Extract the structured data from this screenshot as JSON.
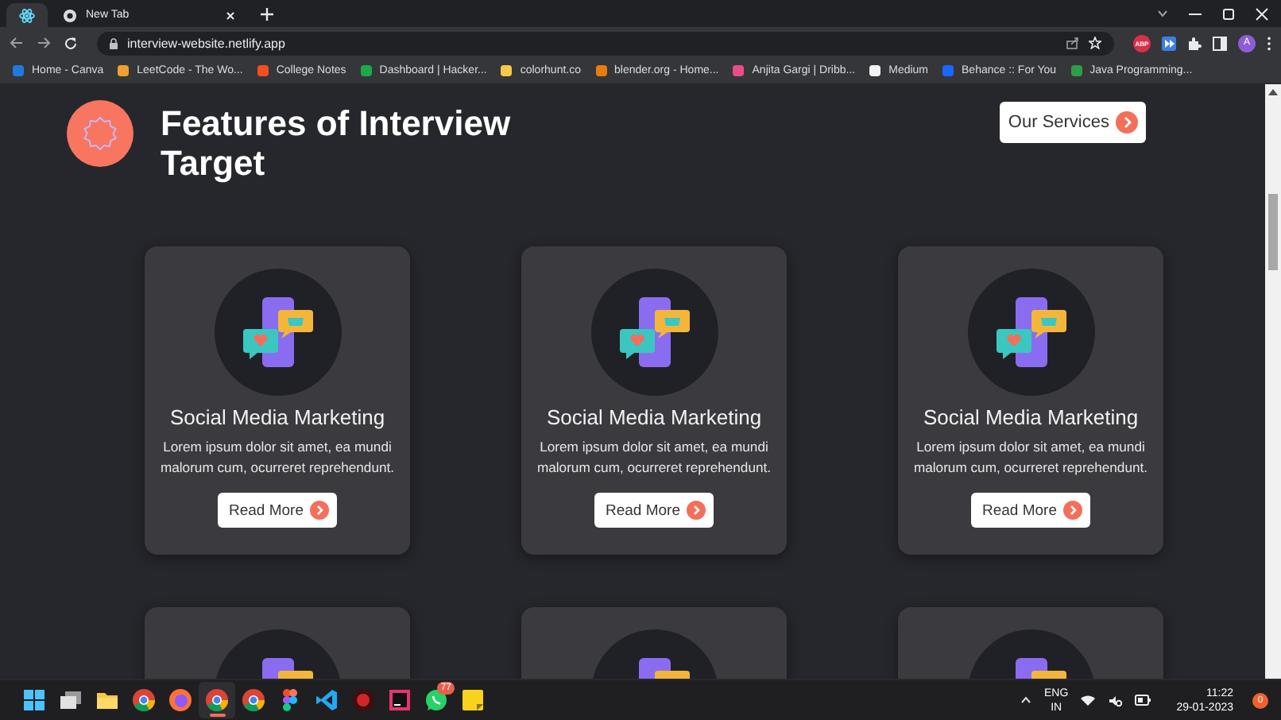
{
  "browser": {
    "tabs": [
      {
        "kind": "pinned",
        "selected": true
      },
      {
        "kind": "normal",
        "title": "New Tab",
        "selected": false
      }
    ],
    "address": "interview-website.netlify.app",
    "extension_label": "ABP",
    "profile_initial": "A",
    "bookmarks": [
      {
        "label": "Home - Canva",
        "color": "#1f7ae0"
      },
      {
        "label": "LeetCode - The Wo...",
        "color": "#f0a030"
      },
      {
        "label": "College Notes",
        "color": "#f25022"
      },
      {
        "label": "Dashboard | Hacker...",
        "color": "#1ba94c"
      },
      {
        "label": "colorhunt.co",
        "color": "#f7c948"
      },
      {
        "label": "blender.org - Home...",
        "color": "#e87d0d"
      },
      {
        "label": "Anjita Gargi | Dribb...",
        "color": "#ea4c89"
      },
      {
        "label": "Medium",
        "color": "#f2f2f2"
      },
      {
        "label": "Behance :: For You",
        "color": "#1769ff"
      },
      {
        "label": "Java Programming...",
        "color": "#2e9d4a"
      }
    ]
  },
  "page": {
    "title": "Features of Interview Target",
    "button": "Our Services",
    "cards": [
      {
        "kind": "full",
        "title": "Social Media Marketing",
        "text": "Lorem ipsum dolor sit amet, ea mundi malorum cum, ocurreret reprehendunt.",
        "button": "Read More"
      },
      {
        "kind": "full",
        "title": "Social Media Marketing",
        "text": "Lorem ipsum dolor sit amet, ea mundi malorum cum, ocurreret reprehendunt.",
        "button": "Read More"
      },
      {
        "kind": "full",
        "title": "Social Media Marketing",
        "text": "Lorem ipsum dolor sit amet, ea mundi malorum cum, ocurreret reprehendunt.",
        "button": "Read More"
      },
      {
        "kind": "partial"
      },
      {
        "kind": "partial"
      },
      {
        "kind": "partial"
      }
    ]
  },
  "taskbar": {
    "apps": [
      {
        "kind": "start",
        "active": false
      },
      {
        "kind": "taskview",
        "active": false
      },
      {
        "kind": "explorer",
        "active": false
      },
      {
        "kind": "chrome",
        "active": false
      },
      {
        "kind": "firefox",
        "active": false
      },
      {
        "kind": "chrome",
        "active": true
      },
      {
        "kind": "chrome",
        "active": false
      },
      {
        "kind": "figma",
        "active": false
      },
      {
        "kind": "vscode",
        "active": false
      },
      {
        "kind": "redapp",
        "active": false
      },
      {
        "kind": "jetbrains",
        "active": false
      },
      {
        "kind": "whatsapp",
        "active": false,
        "badge": "77"
      },
      {
        "kind": "notes",
        "active": false
      }
    ],
    "language": "ENG",
    "region": "IN",
    "time": "11:22",
    "date": "29-01-2023",
    "notifications": "0"
  }
}
